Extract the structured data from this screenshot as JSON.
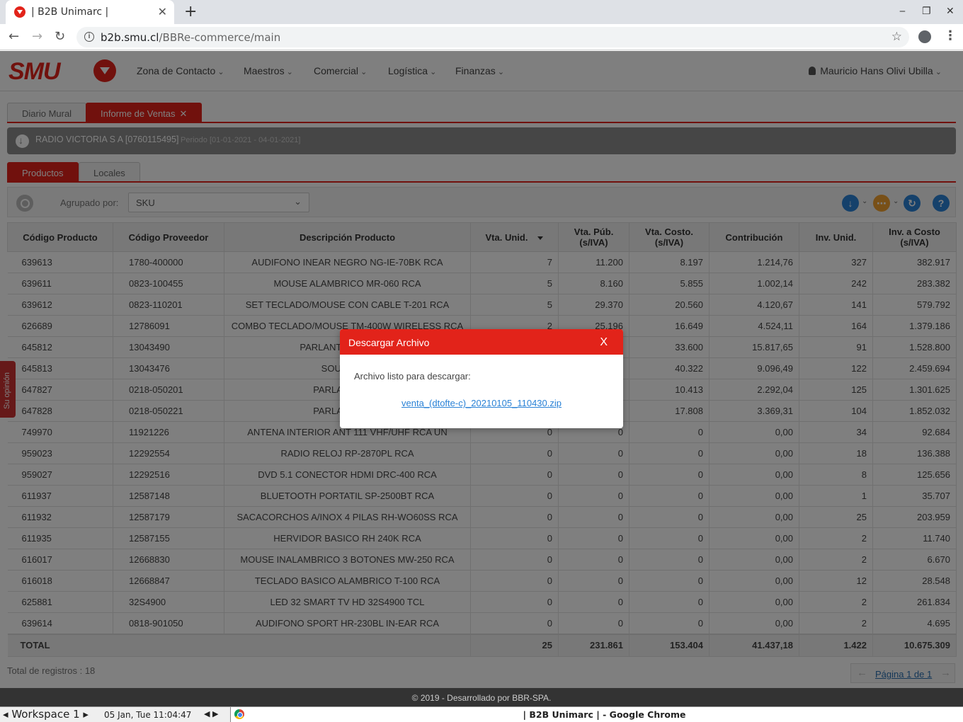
{
  "browser": {
    "tab_title": "| B2B Unimarc |",
    "url_host": "b2b.smu.cl",
    "url_path": "/BBRe-commerce/main"
  },
  "app": {
    "logo_text": "SMU",
    "nav": [
      "Zona de Contacto",
      "Maestros",
      "Comercial",
      "Logística",
      "Finanzas"
    ],
    "user": "Mauricio Hans Olivi Ubilla",
    "main_tabs": [
      "Diario Mural",
      "Informe de Ventas"
    ],
    "company": "RADIO VICTORIA S A [0760115495]",
    "period": "Periodo [01-01-2021 - 04-01-2021]",
    "sub_tabs": [
      "Productos",
      "Locales"
    ],
    "group_label": "Agrupado por:",
    "group_value": "SKU",
    "opinion": "Su opinión"
  },
  "table": {
    "headers": [
      "Código Producto",
      "Código Proveedor",
      "Descripción Producto",
      "Vta. Unid.",
      "Vta. Púb. (s/IVA)",
      "Vta. Costo. (s/IVA)",
      "Contribución",
      "Inv. Unid.",
      "Inv. a Costo (s/IVA)"
    ],
    "rows": [
      [
        "639613",
        "1780-400000",
        "AUDIFONO INEAR NEGRO NG-IE-70BK RCA",
        "7",
        "11.200",
        "8.197",
        "1.214,76",
        "327",
        "382.917"
      ],
      [
        "639611",
        "0823-100455",
        "MOUSE ALAMBRICO MR-060 RCA",
        "5",
        "8.160",
        "5.855",
        "1.002,14",
        "242",
        "283.382"
      ],
      [
        "639612",
        "0823-110201",
        "SET TECLADO/MOUSE CON CABLE T-201 RCA",
        "5",
        "29.370",
        "20.560",
        "4.120,67",
        "141",
        "579.792"
      ],
      [
        "626689",
        "12786091",
        "COMBO TECLADO/MOUSE TM-400W WIRELESS RCA",
        "2",
        "25.196",
        "16.649",
        "4.524,11",
        "164",
        "1.379.186"
      ],
      [
        "645812",
        "13043490",
        "PARLANTE KARAOKE",
        "",
        "",
        "33.600",
        "15.817,65",
        "91",
        "1.528.800"
      ],
      [
        "645813",
        "13043476",
        "SOUNDBAR",
        "",
        "",
        "40.322",
        "9.096,49",
        "122",
        "2.459.694"
      ],
      [
        "647827",
        "0218-050201",
        "PARLANTE BAZ",
        "",
        "",
        "10.413",
        "2.292,04",
        "125",
        "1.301.625"
      ],
      [
        "647828",
        "0218-050221",
        "PARLANTE BAZ",
        "",
        "",
        "17.808",
        "3.369,31",
        "104",
        "1.852.032"
      ],
      [
        "749970",
        "11921226",
        "ANTENA INTERIOR ANT 111 VHF/UHF RCA UN",
        "0",
        "0",
        "0",
        "0,00",
        "34",
        "92.684"
      ],
      [
        "959023",
        "12292554",
        "RADIO RELOJ RP-2870PL RCA",
        "0",
        "0",
        "0",
        "0,00",
        "18",
        "136.388"
      ],
      [
        "959027",
        "12292516",
        "DVD 5.1 CONECTOR HDMI DRC-400 RCA",
        "0",
        "0",
        "0",
        "0,00",
        "8",
        "125.656"
      ],
      [
        "611937",
        "12587148",
        "BLUETOOTH PORTATIL SP-2500BT RCA",
        "0",
        "0",
        "0",
        "0,00",
        "1",
        "35.707"
      ],
      [
        "611932",
        "12587179",
        "SACACORCHOS A/INOX 4 PILAS RH-WO60SS RCA",
        "0",
        "0",
        "0",
        "0,00",
        "25",
        "203.959"
      ],
      [
        "611935",
        "12587155",
        "HERVIDOR BASICO RH 240K RCA",
        "0",
        "0",
        "0",
        "0,00",
        "2",
        "11.740"
      ],
      [
        "616017",
        "12668830",
        "MOUSE INALAMBRICO 3 BOTONES MW-250 RCA",
        "0",
        "0",
        "0",
        "0,00",
        "2",
        "6.670"
      ],
      [
        "616018",
        "12668847",
        "TECLADO BASICO ALAMBRICO T-100 RCA",
        "0",
        "0",
        "0",
        "0,00",
        "12",
        "28.548"
      ],
      [
        "625881",
        "32S4900",
        "LED 32 SMART TV HD 32S4900 TCL",
        "0",
        "0",
        "0",
        "0,00",
        "2",
        "261.834"
      ],
      [
        "639614",
        "0818-901050",
        "AUDIFONO SPORT HR-230BL IN-EAR RCA",
        "0",
        "0",
        "0",
        "0,00",
        "2",
        "4.695"
      ]
    ],
    "total_label": "TOTAL",
    "totals": [
      "25",
      "231.861",
      "153.404",
      "41.437,18",
      "1.422",
      "10.675.309"
    ],
    "record_count": "Total de registros : 18",
    "pager": "Página 1 de 1"
  },
  "footer": "© 2019 - Desarrollado por BBR-SPA.",
  "modal": {
    "title": "Descargar Archivo",
    "close": "X",
    "message": "Archivo listo para descargar:",
    "link": "venta_(dtofte-c)_20210105_110430.zip"
  },
  "taskbar": {
    "workspace": "Workspace 1",
    "clock": "05 Jan, Tue 11:04:47",
    "window_title": "| B2B Unimarc | - Google Chrome"
  }
}
